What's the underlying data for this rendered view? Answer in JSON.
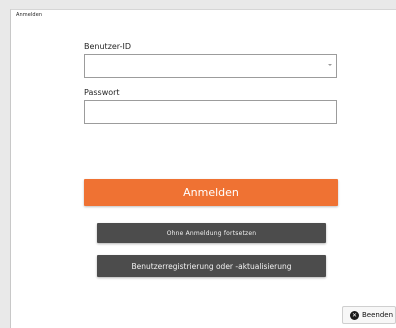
{
  "window": {
    "title": "Anmelden"
  },
  "form": {
    "user_label": "Benutzer-ID",
    "user_value": "",
    "password_label": "Passwort",
    "password_value": ""
  },
  "buttons": {
    "login": "Anmelden",
    "skip": "Ohne Anmeldung fortsetzen",
    "register": "Benutzerregistrierung oder -aktualisierung",
    "quit": "Beenden"
  },
  "icons": {
    "user_dropdown": "chevron-down-icon",
    "quit": "close-circle-icon"
  },
  "colors": {
    "login_button": "#ef7233",
    "secondary_buttons": "#4c4c4c"
  }
}
